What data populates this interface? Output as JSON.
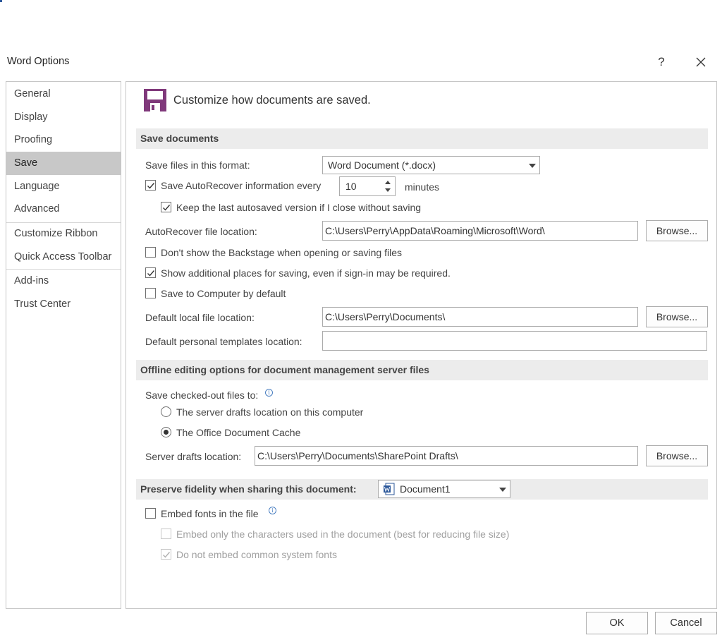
{
  "window": {
    "title": "Word Options",
    "help_label": "?"
  },
  "nav": {
    "items": [
      {
        "label": "General"
      },
      {
        "label": "Display"
      },
      {
        "label": "Proofing"
      },
      {
        "label": "Save",
        "selected": true
      },
      {
        "label": "Language"
      },
      {
        "label": "Advanced"
      },
      {
        "label": "Customize Ribbon"
      },
      {
        "label": "Quick Access Toolbar"
      },
      {
        "label": "Add-ins"
      },
      {
        "label": "Trust Center"
      }
    ]
  },
  "header": {
    "icon": "save-icon",
    "text": "Customize how documents are saved."
  },
  "save_documents": {
    "section_title": "Save documents",
    "format_label": "Save files in this format:",
    "format_value": "Word Document (*.docx)",
    "autorecover_label": "Save AutoRecover information every",
    "autorecover_checked": true,
    "autorecover_minutes": "10",
    "minutes_label": "minutes",
    "keep_last_label": "Keep the last autosaved version if I close without saving",
    "keep_last_checked": true,
    "autorecover_location_label": "AutoRecover file location:",
    "autorecover_location_value": "C:\\Users\\Perry\\AppData\\Roaming\\Microsoft\\Word\\",
    "browse_label": "Browse...",
    "backstage_label": "Don't show the Backstage when opening or saving files",
    "backstage_checked": false,
    "additional_places_label": "Show additional places for saving, even if sign-in may be required.",
    "additional_places_checked": true,
    "save_to_computer_label": "Save to Computer by default",
    "save_to_computer_checked": false,
    "default_location_label": "Default local file location:",
    "default_location_value": "C:\\Users\\Perry\\Documents\\",
    "templates_location_label": "Default personal templates location:",
    "templates_location_value": ""
  },
  "offline": {
    "section_title": "Offline editing options for document management server files",
    "checked_out_label": "Save checked-out files to:",
    "radio_server_label": "The server drafts location on this computer",
    "radio_cache_label": "The Office Document Cache",
    "selected_option": "cache",
    "server_drafts_label": "Server drafts location:",
    "server_drafts_value": "C:\\Users\\Perry\\Documents\\SharePoint Drafts\\"
  },
  "fidelity": {
    "section_title": "Preserve fidelity when sharing this document:",
    "document_value": "Document1",
    "embed_fonts_label": "Embed fonts in the file",
    "embed_fonts_checked": false,
    "embed_only_label": "Embed only the characters used in the document (best for reducing file size)",
    "embed_only_checked": false,
    "no_common_label": "Do not embed common system fonts",
    "no_common_checked": true
  },
  "footer": {
    "ok_label": "OK",
    "cancel_label": "Cancel"
  },
  "colors": {
    "accent": "#2b579a",
    "save_icon": "#80397b",
    "selected_nav": "#c8c8c8",
    "section_bg": "#ececec"
  }
}
